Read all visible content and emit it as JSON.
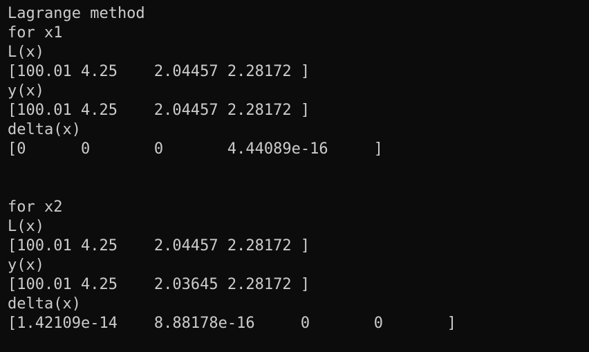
{
  "terminal": {
    "lines": [
      "Lagrange method",
      "for x1",
      "L(x)",
      "[100.01 4.25    2.04457 2.28172 ]",
      "y(x)",
      "[100.01 4.25    2.04457 2.28172 ]",
      "delta(x)",
      "[0      0       0       4.44089e-16     ]",
      "",
      "",
      "for x2",
      "L(x)",
      "[100.01 4.25    2.04457 2.28172 ]",
      "y(x)",
      "[100.01 4.25    2.03645 2.28172 ]",
      "delta(x)",
      "[1.42109e-14    8.88178e-16     0       0       ]"
    ]
  },
  "colors": {
    "background": "#0c0c0c",
    "text": "#cccccc"
  }
}
